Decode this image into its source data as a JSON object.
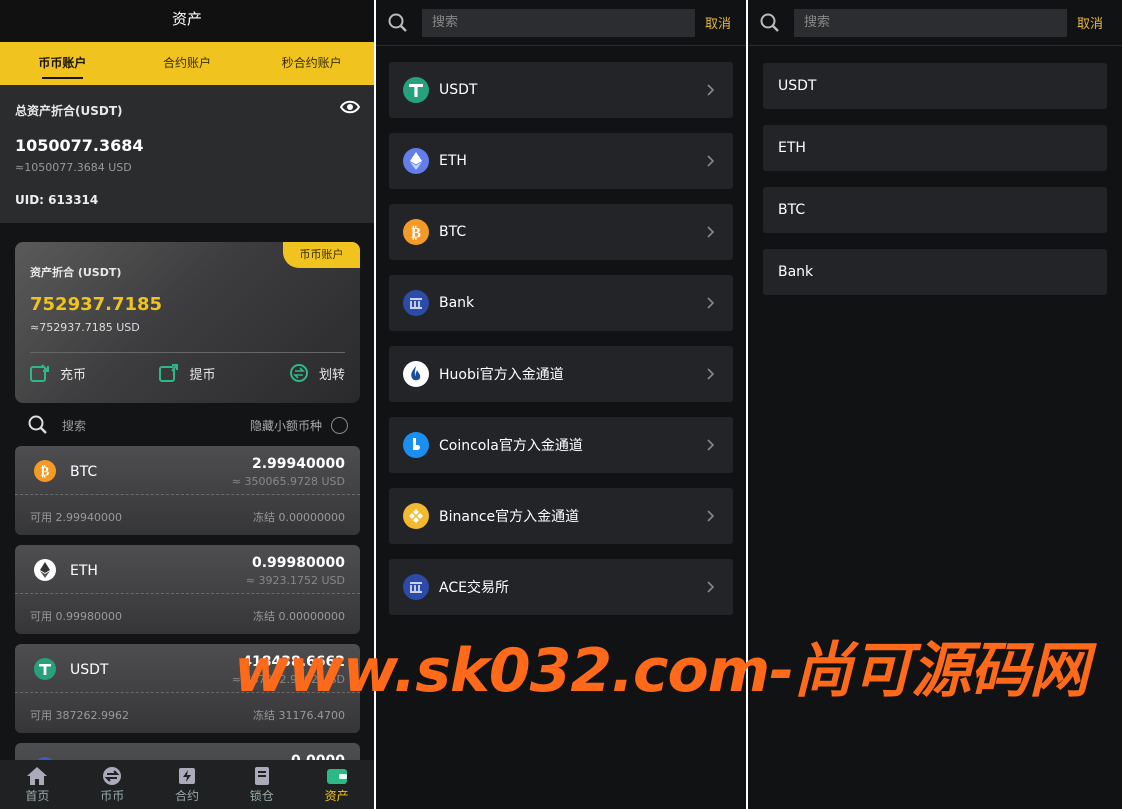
{
  "assets": {
    "header_title": "资产",
    "tabs": [
      "币币账户",
      "合约账户",
      "秒合约账户"
    ],
    "summary": {
      "label": "总资产折合(USDT)",
      "value": "1050077.3684",
      "usd": "≈1050077.3684 USD",
      "uid": "UID: 613314"
    },
    "account_card": {
      "badge": "币币账户",
      "label": "资产折合 (USDT)",
      "value": "752937.7185",
      "usd": "≈752937.7185 USD",
      "actions": [
        "充币",
        "提币",
        "划转"
      ]
    },
    "search_placeholder": "搜索",
    "hide_small": "隐藏小额币种",
    "coins": [
      {
        "name": "BTC",
        "amount": "2.99940000",
        "usd": "≈ 350065.9728 USD",
        "available": "可用 2.99940000",
        "frozen": "冻结 0.00000000"
      },
      {
        "name": "ETH",
        "amount": "0.99980000",
        "usd": "≈ 3923.1752 USD",
        "available": "可用 0.99980000",
        "frozen": "冻结 0.00000000"
      },
      {
        "name": "USDT",
        "amount": "418438.6662",
        "usd": "≈ 387262.9962 USD",
        "available": "可用 387262.9962",
        "frozen": "冻结 31176.4700"
      },
      {
        "name": "",
        "amount": "0.0000",
        "usd": "",
        "available": "",
        "frozen": ""
      }
    ],
    "nav": [
      "首页",
      "币币",
      "合约",
      "锁仓",
      "资产"
    ],
    "colors": {
      "accent": "#f0c31e",
      "bg": "#131416"
    }
  },
  "deposit_channels": {
    "search_placeholder": "搜索",
    "cancel": "取消",
    "items": [
      {
        "label": "USDT",
        "icon": "usdt-icon"
      },
      {
        "label": "ETH",
        "icon": "eth-icon"
      },
      {
        "label": "BTC",
        "icon": "btc-icon"
      },
      {
        "label": "Bank",
        "icon": "bank-icon"
      },
      {
        "label": "Huobi官方入金通道",
        "icon": "huobi-icon"
      },
      {
        "label": "Coincola官方入金通道",
        "icon": "coincola-icon"
      },
      {
        "label": "Binance官方入金通道",
        "icon": "binance-icon"
      },
      {
        "label": "ACE交易所",
        "icon": "bank-icon"
      }
    ]
  },
  "withdraw_channels": {
    "search_placeholder": "搜索",
    "cancel": "取消",
    "items": [
      "USDT",
      "ETH",
      "BTC",
      "Bank"
    ]
  },
  "watermark": "www.sk032.com-尚可源码网"
}
